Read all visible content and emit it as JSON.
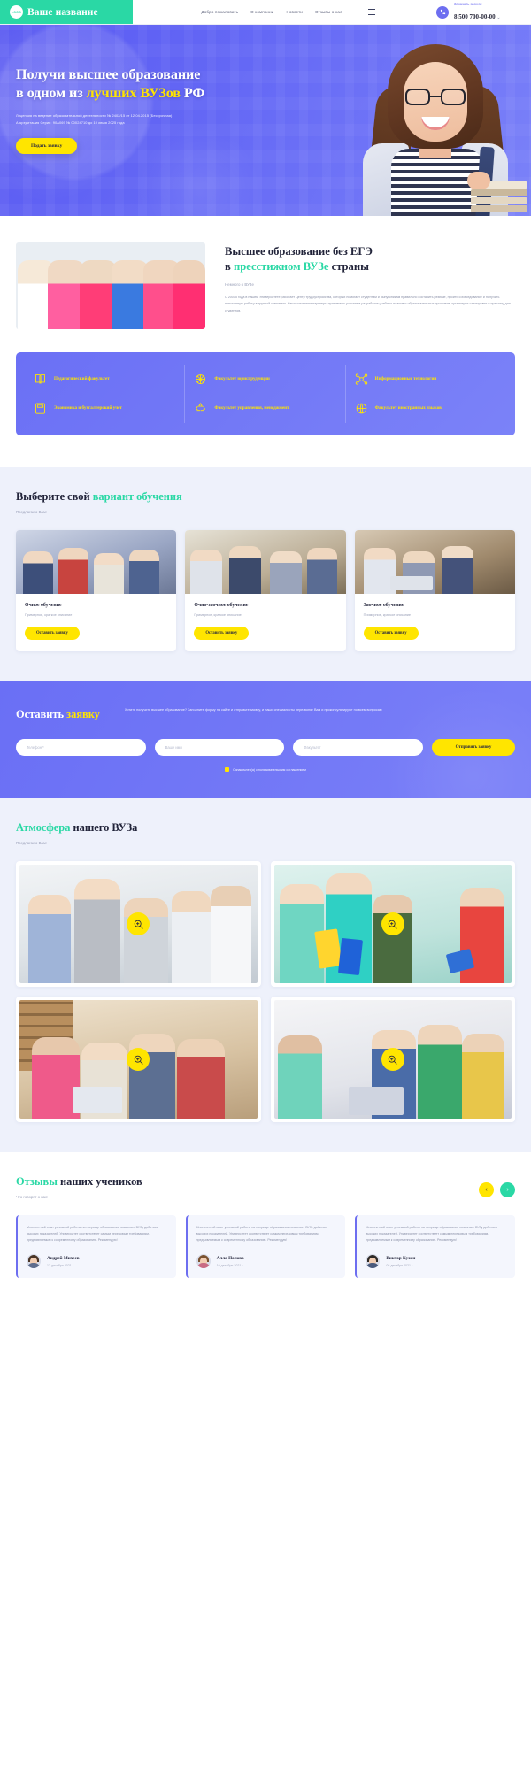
{
  "header": {
    "logo_text": "LOGO",
    "brand": "Ваше название",
    "nav": [
      {
        "label": "Добро пожаловать"
      },
      {
        "label": "О компании"
      },
      {
        "label": "Новости"
      },
      {
        "label": "Отзывы о нас"
      }
    ],
    "menu_icon": "hamburger-icon",
    "phone_icon": "phone-icon",
    "call_label": "Заказать звонок",
    "phone": "8 500 700-00-00",
    "caret": "⌄"
  },
  "hero": {
    "title_line1": "Получи высшее образование",
    "title_line2_a": "в одном из ",
    "title_line2_hl": "лучших ВУЗов",
    "title_line2_b": " РФ",
    "license1": "Лицензия на ведение образовательной деятельности № 2402/15 от 12.04.2015 (Бессрочная)",
    "license2": "Аккредитация Серия: 90А069 № 00024710 до 10 июля 2025 года",
    "cta": "Подать заявку"
  },
  "about": {
    "title_a": "Высшее образование без ЕГЭ",
    "title_b_pre": "в ",
    "title_b_hl": "пресстижном ВУЗе",
    "title_b_post": " страны",
    "subtitle": "Немного о ВУЗе",
    "paragraph": "С 20015 года в нашем Университете работает Центр трудоустройства, который помогает студентам и выпускникам правильно составить резюме, пройти собеседование и получить престижную работу в крупной компании. Наши компании-партнеры принимают участие в разработке учебных планов и образовательных программ, организуют стажировки и практику для студентов."
  },
  "faculties": [
    {
      "icon": "book-icon",
      "label": "Педагогический факультет"
    },
    {
      "icon": "scales-icon",
      "label": "Факультет юриспруденции"
    },
    {
      "icon": "network-icon",
      "label": "Информационные технологии"
    },
    {
      "icon": "calculator-icon",
      "label": "Экономика и бухгалтерский учет"
    },
    {
      "icon": "recycle-icon",
      "label": "Факультет управления, менеджмент"
    },
    {
      "icon": "globe-icon",
      "label": "Факультет иностранных языков"
    }
  ],
  "variants": {
    "title_a": "Выберите свой ",
    "title_hl": "вариант обучения",
    "subtitle": "Предлагаем Вам:",
    "cards": [
      {
        "title": "Очное обучение",
        "desc": "Примерное, краткое описание",
        "cta": "Оставить заявку"
      },
      {
        "title": "Очно-заочное обучение",
        "desc": "Примерное, краткое описание",
        "cta": "Оставить заявку"
      },
      {
        "title": "Заочное обучение",
        "desc": "Примерное, краткое описание",
        "cta": "Оставить заявку"
      }
    ]
  },
  "form": {
    "title_a": "Оставить ",
    "title_hl": "заявку",
    "description": "Хотите получить высшее образование? Заполните форму на сайте и отправьте заявку, и наши специалисты перезвонят Вам и проконсультируют по всем вопросам",
    "fields": [
      {
        "name": "phone-field",
        "placeholder": "Телефон *"
      },
      {
        "name": "name-field",
        "placeholder": "Ваше имя"
      },
      {
        "name": "faculty-field",
        "placeholder": "Факультет"
      }
    ],
    "submit": "Отправить заявку",
    "agreement": "Ознакомлен(а) с пользовательским соглашением"
  },
  "gallery": {
    "title_hl": "Атмосфера",
    "title_b": " нашего ВУЗа",
    "subtitle": "Предлагаем Вам:",
    "zoom_icon": "magnifier-plus-icon",
    "items": [
      {
        "alt": "students-corridor"
      },
      {
        "alt": "students-folders"
      },
      {
        "alt": "students-library"
      },
      {
        "alt": "students-laptop"
      }
    ]
  },
  "reviews": {
    "title_hl": "Отзывы",
    "title_b": " наших учеников",
    "subtitle": "Что говорят о нас:",
    "prev_icon": "chevron-left-icon",
    "next_icon": "chevron-right-icon",
    "items": [
      {
        "text": "Многолетний опыт успешной работы на поприще образования позволяет ВУЗу добиться высоких показателей. Университет соответствует самым передовым требованиям, предъявляемым к современному образованию. Рекомендую!",
        "name": "Андрей Михеев",
        "date": "12 декабря 2021 г."
      },
      {
        "text": "Многолетний опыт успешной работы на поприще образования позволяет ВУЗу добиться высоких показателей. Университет соответствует самым передовым требованиям, предъявляемым к современному образованию. Рекомендую!",
        "name": "Алла Попова",
        "date": "10 декабря 2021 г."
      },
      {
        "text": "Многолетний опыт успешной работы на поприще образования позволяет ВУЗу добиться высоких показателей. Университет соответствует самым передовым требованиям, предъявляемым к современному образованию. Рекомендую!",
        "name": "Виктор Кузин",
        "date": "08 декабря 2021 г."
      }
    ]
  },
  "colors": {
    "brand_green": "#2ad8a5",
    "accent_purple": "#6d6ef0",
    "accent_yellow": "#ffe500",
    "light_bg": "#eef1fb"
  }
}
